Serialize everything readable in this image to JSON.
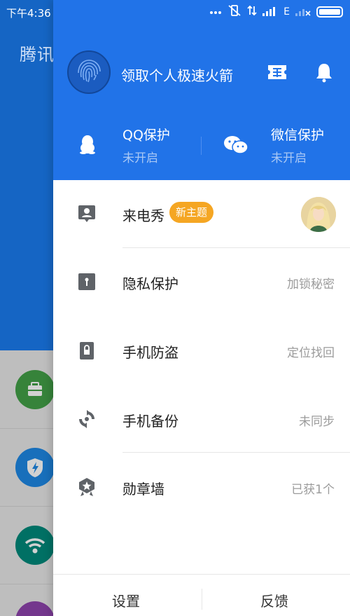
{
  "status_bar": {
    "time": "下午4:36",
    "network": "E"
  },
  "background_app": {
    "title": "腾讯"
  },
  "drawer": {
    "promo_text": "领取个人极速火箭",
    "protection": [
      {
        "title": "QQ保护",
        "status": "未开启",
        "icon": "qq-penguin-icon"
      },
      {
        "title": "微信保护",
        "status": "未开启",
        "icon": "wechat-icon"
      }
    ],
    "menu": [
      {
        "label": "来电秀",
        "badge": "新主题",
        "value": "",
        "icon": "contact-card-icon"
      },
      {
        "label": "隐私保护",
        "value": "加锁秘密",
        "icon": "keyhole-icon"
      },
      {
        "label": "手机防盗",
        "value": "定位找回",
        "icon": "lock-icon"
      },
      {
        "label": "手机备份",
        "value": "未同步",
        "icon": "sync-icon"
      },
      {
        "label": "勋章墙",
        "value": "已获1个",
        "icon": "medal-icon"
      }
    ],
    "footer": {
      "settings": "设置",
      "feedback": "反馈"
    }
  },
  "colors": {
    "header_blue": "#2173e8",
    "badge_orange": "#f5a623",
    "background_blue": "#1565c4"
  }
}
